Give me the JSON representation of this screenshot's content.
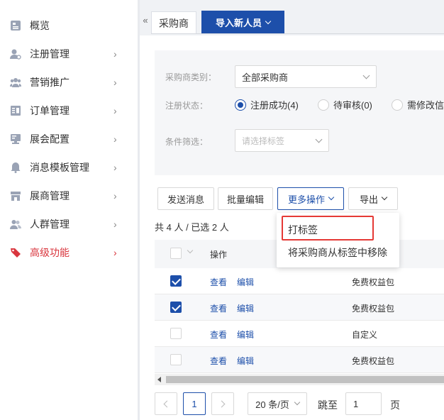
{
  "sidebar": {
    "items": [
      {
        "label": "概览",
        "icon": "overview-icon",
        "has_arrow": false
      },
      {
        "label": "注册管理",
        "icon": "user-register-icon",
        "has_arrow": true
      },
      {
        "label": "营销推广",
        "icon": "users-group-icon",
        "has_arrow": true
      },
      {
        "label": "订单管理",
        "icon": "order-icon",
        "has_arrow": true
      },
      {
        "label": "展会配置",
        "icon": "monitor-icon",
        "has_arrow": true
      },
      {
        "label": "消息模板管理",
        "icon": "bell-icon",
        "has_arrow": true
      },
      {
        "label": "展商管理",
        "icon": "store-icon",
        "has_arrow": true
      },
      {
        "label": "人群管理",
        "icon": "people-icon",
        "has_arrow": true
      },
      {
        "label": "高级功能",
        "icon": "tag-icon",
        "has_arrow": true,
        "active": true
      }
    ],
    "arrow_glyph": "›"
  },
  "tabs": {
    "collapse_glyph": "«",
    "current": "采购商",
    "import_label": "导入新人员"
  },
  "filter": {
    "category_label": "采购商类别：",
    "category_value": "全部采购商",
    "status_label": "注册状态：",
    "status_options": [
      {
        "label": "注册成功(4)",
        "checked": true
      },
      {
        "label": "待审核(0)",
        "checked": false
      },
      {
        "label": "需修改信",
        "checked": false
      }
    ],
    "condition_label": "条件筛选：",
    "condition_placeholder": "请选择标签"
  },
  "toolbar": {
    "send_message": "发送消息",
    "bulk_edit": "批量编辑",
    "more_actions": "更多操作",
    "export": "导出"
  },
  "selection_text": "共 4 人 / 已选 2 人",
  "table": {
    "header_action": "操作",
    "rows": [
      {
        "checked": true,
        "view": "查看",
        "edit": "编辑",
        "package": "免费权益包"
      },
      {
        "checked": true,
        "view": "查看",
        "edit": "编辑",
        "package": "免费权益包"
      },
      {
        "checked": false,
        "view": "查看",
        "edit": "编辑",
        "package": "自定义"
      },
      {
        "checked": false,
        "view": "查看",
        "edit": "编辑",
        "package": "免费权益包"
      }
    ]
  },
  "dropdown_menu": {
    "items": [
      "打标签",
      "将采购商从标签中移除"
    ]
  },
  "pagination": {
    "current_page": "1",
    "page_size": "20 条/页",
    "jump_label": "跳至",
    "jump_value": "1",
    "page_suffix": "页"
  },
  "colors": {
    "primary": "#1d4faa",
    "active_nav": "#d9363e",
    "highlight": "#e53935"
  }
}
